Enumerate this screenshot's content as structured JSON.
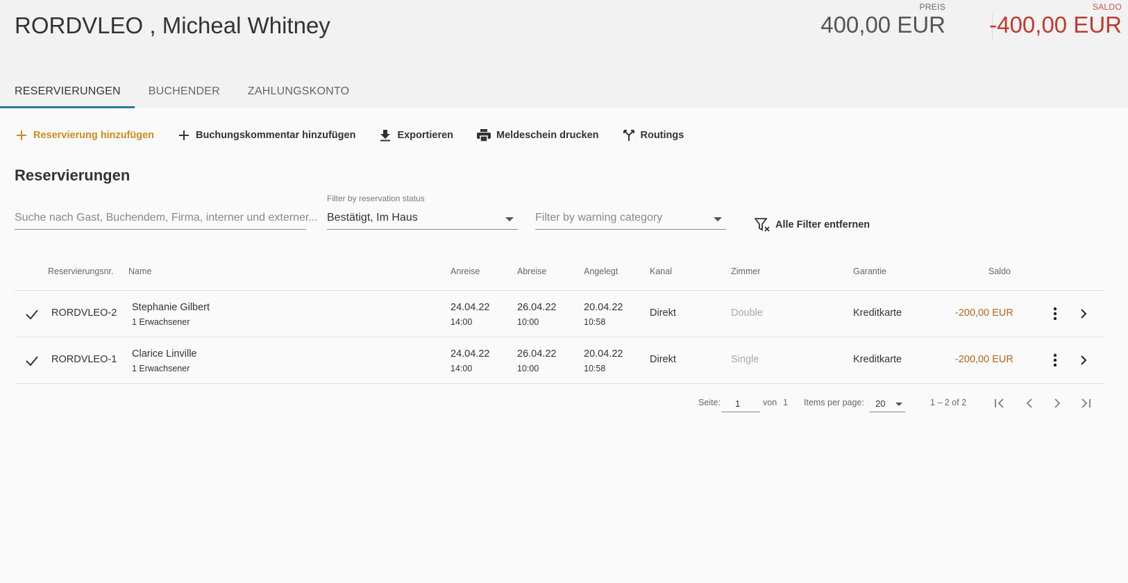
{
  "header": {
    "title": "RORDVLEO , Micheal Whitney",
    "price_label": "PREIS",
    "price_value": "400,00 EUR",
    "saldo_label": "SALDO",
    "saldo_value": "-400,00 EUR"
  },
  "tabs": [
    {
      "label": "RESERVIERUNGEN",
      "active": true
    },
    {
      "label": "BUCHENDER",
      "active": false
    },
    {
      "label": "ZAHLUNGSKONTO",
      "active": false
    }
  ],
  "toolbar": {
    "add_reservation": "Reservierung hinzufügen",
    "add_comment": "Buchungskommentar hinzufügen",
    "export": "Exportieren",
    "print_form": "Meldeschein drucken",
    "routings": "Routings"
  },
  "section_title": "Reservierungen",
  "filters": {
    "search_placeholder": "Suche nach Gast, Buchendem, Firma, interner und externer...",
    "status_label": "Filter by reservation status",
    "status_value": "Bestätigt, Im Haus",
    "warning_placeholder": "Filter by warning category",
    "clear_all": "Alle Filter entfernen"
  },
  "table": {
    "headers": {
      "reservation_no": "Reservierungsnr.",
      "name": "Name",
      "arrival": "Anreise",
      "departure": "Abreise",
      "created": "Angelegt",
      "channel": "Kanal",
      "room": "Zimmer",
      "guarantee": "Garantie",
      "balance": "Saldo"
    },
    "rows": [
      {
        "reservation_no": "RORDVLEO-2",
        "name": "Stephanie Gilbert",
        "guests": "1 Erwachsener",
        "arrival_date": "24.04.22",
        "arrival_time": "14:00",
        "departure_date": "26.04.22",
        "departure_time": "10:00",
        "created_date": "20.04.22",
        "created_time": "10:58",
        "channel": "Direkt",
        "room": "Double",
        "guarantee": "Kreditkarte",
        "balance": "-200,00 EUR"
      },
      {
        "reservation_no": "RORDVLEO-1",
        "name": "Clarice Linville",
        "guests": "1 Erwachsener",
        "arrival_date": "24.04.22",
        "arrival_time": "14:00",
        "departure_date": "26.04.22",
        "departure_time": "10:00",
        "created_date": "20.04.22",
        "created_time": "10:58",
        "channel": "Direkt",
        "room": "Single",
        "guarantee": "Kreditkarte",
        "balance": "-200,00 EUR"
      }
    ]
  },
  "paginator": {
    "page_label": "Seite:",
    "page_value": "1",
    "of_label": "von",
    "total_pages": "1",
    "items_per_page_label": "Items per page:",
    "items_per_page_value": "20",
    "range": "1 – 2 of 2"
  },
  "colors": {
    "accent": "#d08a1e",
    "tab_indicator": "#2a7aa0",
    "negative": "#c0392b",
    "negative_row": "#b0661c"
  }
}
